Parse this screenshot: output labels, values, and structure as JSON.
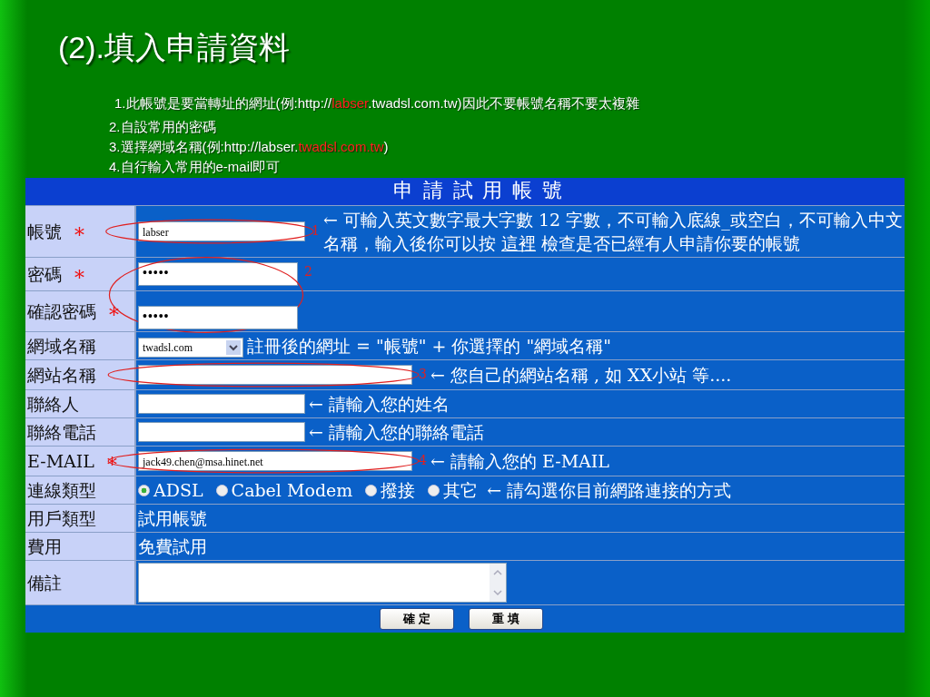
{
  "slide": {
    "title": "(2).填入申請資料",
    "notes": [
      {
        "parts": [
          {
            "text": "1.此帳號是要當轉址的網址(例:http://",
            "highlight": false
          },
          {
            "text": "labser",
            "highlight": true
          },
          {
            "text": ".twadsl.com.tw)因此不要帳號名稱不要太複雜",
            "highlight": false
          }
        ]
      },
      {
        "parts": [
          {
            "text": "2.自設常用的密碼",
            "highlight": false
          }
        ]
      },
      {
        "parts": [
          {
            "text": "3.選擇網域名稱(例:http://labser.",
            "highlight": false
          },
          {
            "text": "twadsl.com.tw",
            "highlight": true
          },
          {
            "text": ")",
            "highlight": false
          }
        ]
      },
      {
        "parts": [
          {
            "text": "4.自行輸入常用的e-mail即可",
            "highlight": false
          }
        ]
      }
    ]
  },
  "form": {
    "title": "申 請 試 用 帳 號",
    "rows": [
      {
        "label": "帳號",
        "required_mark": "∗",
        "kind": "input",
        "value": "labser",
        "annotation": "1",
        "hint_parts": [
          {
            "text": "← 可輸入英文數字最大字數 12 字數，不可輸入底線_或空白，不可輸入中文名稱，輸入後你可以按 ",
            "link": false
          },
          {
            "text": "這裡",
            "link": true
          },
          {
            "text": " 檢查是否已經有人申請你要的帳號",
            "link": false
          }
        ]
      },
      {
        "label": "密碼",
        "required_mark": "∗",
        "kind": "input",
        "value": "•••••",
        "annotation": "2"
      },
      {
        "label": "確認密碼",
        "required_mark": "∗",
        "kind": "input",
        "value": "•••••"
      },
      {
        "label": "網域名稱",
        "kind": "select",
        "value": "twadsl.com",
        "hint_parts": [
          {
            "text": "註冊後的網址 = \"帳號\" + 你選擇的 \"網域名稱\"",
            "link": false
          }
        ]
      },
      {
        "label": "網站名稱",
        "kind": "input",
        "value": "",
        "annotation": "3",
        "hint_parts": [
          {
            "text": "← 您自己的網站名稱 , 如 XX小站 等....",
            "link": false
          }
        ]
      },
      {
        "label": "聯絡人",
        "kind": "input",
        "value": "",
        "hint_parts": [
          {
            "text": "← 請輸入您的姓名",
            "link": false
          }
        ]
      },
      {
        "label": "聯絡電話",
        "kind": "input",
        "value": "",
        "hint_parts": [
          {
            "text": "← 請輸入您的聯絡電話",
            "link": false
          }
        ]
      },
      {
        "label": "E-MAIL",
        "required_mark": "∗",
        "kind": "input",
        "value": "jack49.chen@msa.hinet.net",
        "annotation": "4",
        "hint_parts": [
          {
            "text": "← 請輸入您的 E-MAIL",
            "link": false
          }
        ]
      },
      {
        "label": "連線類型",
        "kind": "radio",
        "options": [
          {
            "label": "ADSL",
            "selected": true
          },
          {
            "label": "Cabel Modem",
            "selected": false
          },
          {
            "label": "撥接",
            "selected": false
          },
          {
            "label": "其它",
            "selected": false
          }
        ],
        "hint_parts": [
          {
            "text": "← 請勾選你目前網路連接的方式",
            "link": false
          }
        ]
      },
      {
        "label": "用戶類型",
        "kind": "text",
        "value": "試用帳號"
      },
      {
        "label": "費用",
        "kind": "text",
        "value": "免費試用"
      },
      {
        "label": "備註",
        "kind": "textarea",
        "value": ""
      }
    ],
    "buttons": [
      "確 定",
      "重 填"
    ]
  }
}
